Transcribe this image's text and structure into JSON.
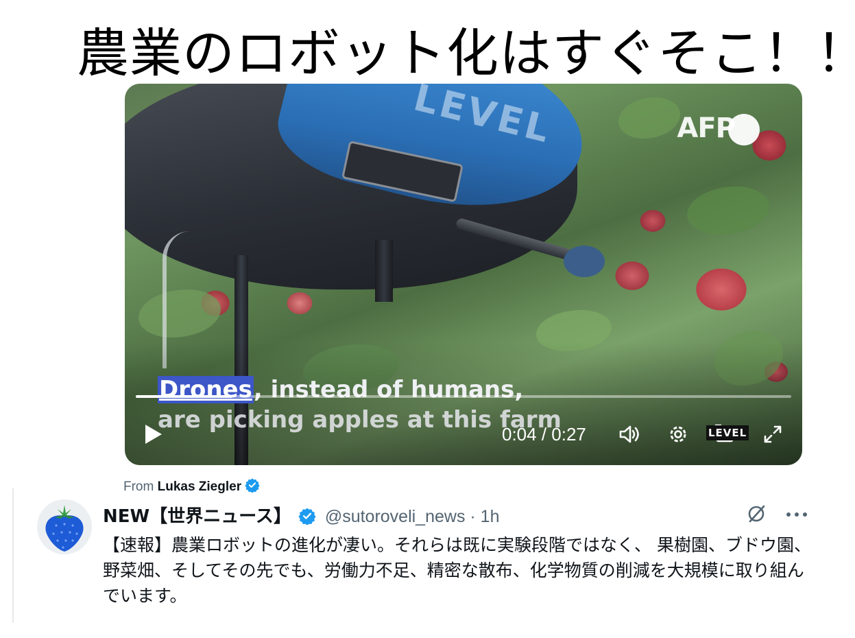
{
  "headline": "農業のロボット化はすぐそこ！！",
  "video": {
    "watermark_top": "AFP",
    "shell_text": "LEVEL",
    "watermark_bottom": "LEVEL",
    "caption_highlight": "Drones",
    "caption_line1_rest": ", instead of humans,",
    "caption_line2": "are picking apples at this farm",
    "time": "0:04 / 0:27",
    "progress_fraction": 0.148,
    "icons": [
      "play-icon",
      "volume-icon",
      "settings-icon",
      "pip-icon",
      "fullscreen-icon"
    ]
  },
  "attribution": {
    "prefix": "From",
    "name": "Lukas Ziegler"
  },
  "tweet": {
    "author": "NEW【世界ニュース】",
    "handle_time": "@sutoroveli_news · 1h",
    "text": "【速報】農業ロボットの進化が凄い。それらは既に実験段階ではなく、 果樹園、ブドウ園、野菜畑、そしてその先でも、労働力不足、精密な散布、化学物質の削減を大規模に取り組んでいます。"
  },
  "colors": {
    "verified": "#1d9bf0",
    "caption_highlight": "#3d56c8",
    "secondary_text": "#536471"
  }
}
